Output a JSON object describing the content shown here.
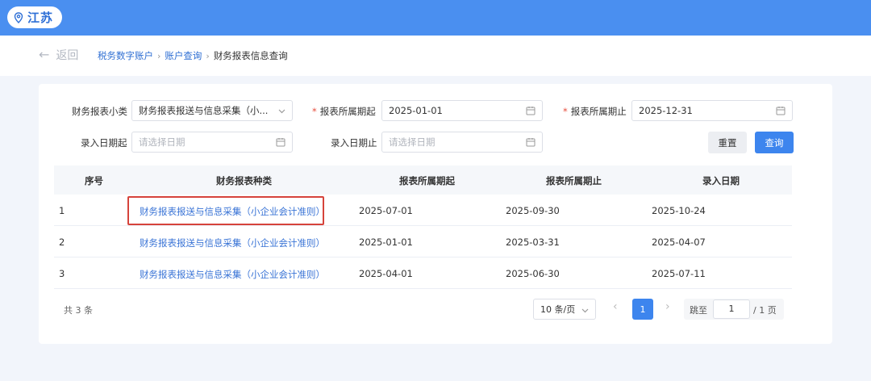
{
  "header": {
    "region": "江苏",
    "bg_color": "#4a8ff0"
  },
  "nav": {
    "back_label": "返回",
    "breadcrumbs": [
      "税务数字账户",
      "账户查询",
      "财务报表信息查询"
    ],
    "separator": "›"
  },
  "filters": {
    "subcategory": {
      "label": "财务报表小类",
      "value": "财务报表报送与信息采集（小..."
    },
    "period_start": {
      "label": "报表所属期起",
      "required": "*",
      "value": "2025-01-01"
    },
    "period_end": {
      "label": "报表所属期止",
      "required": "*",
      "value": "2025-12-31"
    },
    "entry_start": {
      "label": "录入日期起",
      "placeholder": "请选择日期"
    },
    "entry_end": {
      "label": "录入日期止",
      "placeholder": "请选择日期"
    },
    "reset_label": "重置",
    "query_label": "查询"
  },
  "table": {
    "columns": [
      "序号",
      "财务报表种类",
      "报表所属期起",
      "报表所属期止",
      "录入日期"
    ],
    "rows": [
      [
        "1",
        "财务报表报送与信息采集（小企业会计准则）",
        "2025-07-01",
        "2025-09-30",
        "2025-10-24"
      ],
      [
        "2",
        "财务报表报送与信息采集（小企业会计准则）",
        "2025-01-01",
        "2025-03-31",
        "2025-04-07"
      ],
      [
        "3",
        "财务报表报送与信息采集（小企业会计准则）",
        "2025-04-01",
        "2025-06-30",
        "2025-07-11"
      ]
    ],
    "highlight_color": "#d6433b"
  },
  "pagination": {
    "total": "共 3 条",
    "page_size": "10 条/页",
    "prev": "‹",
    "next": "›",
    "current_page": "1",
    "jump_label": "跳至",
    "jump_value": "1",
    "page_total": "/ 1 页"
  },
  "accent_color": "#3d85ee"
}
